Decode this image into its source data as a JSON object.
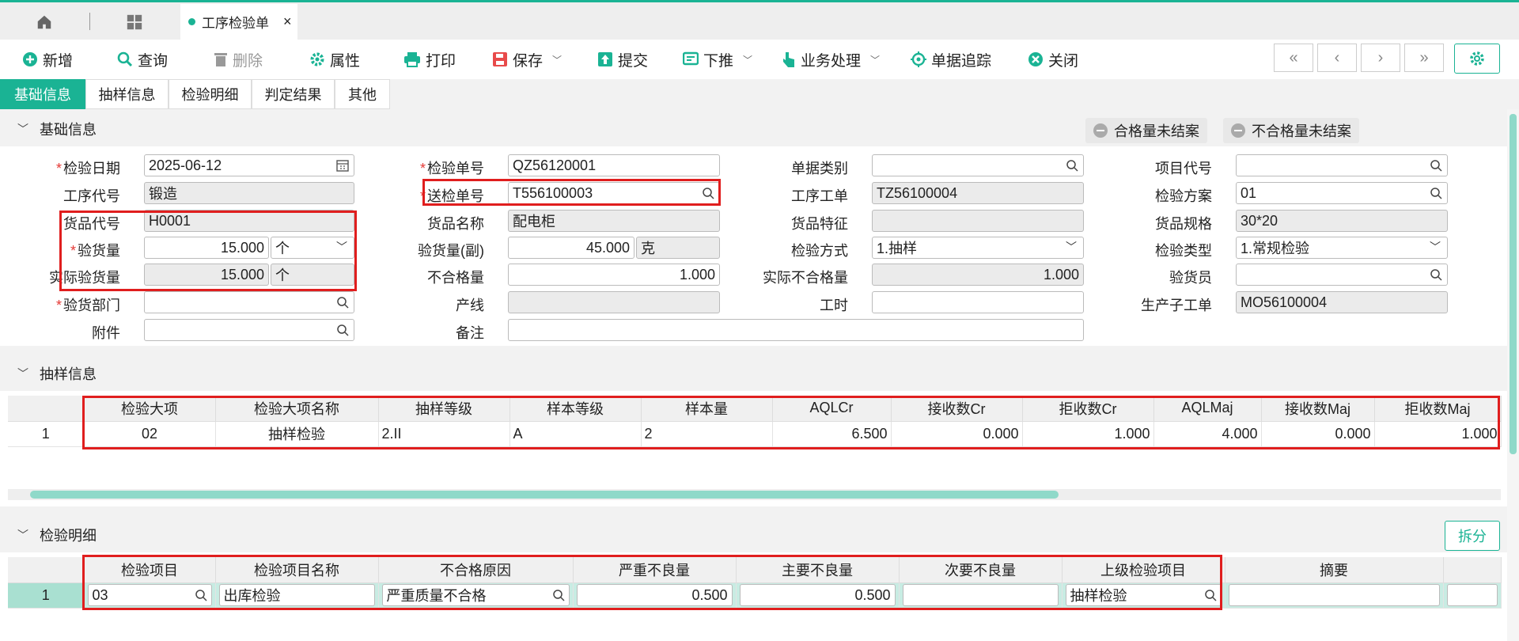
{
  "tabbar": {
    "doc_tab": "工序检验单",
    "close": "×"
  },
  "toolbar": {
    "new": "新增",
    "query": "查询",
    "delete": "删除",
    "attr": "属性",
    "print": "打印",
    "save": "保存",
    "submit": "提交",
    "push": "下推",
    "business": "业务处理",
    "trace": "单据追踪",
    "close": "关闭",
    "nav": [
      "«",
      "‹",
      "›",
      "»"
    ]
  },
  "subtabs": [
    "基础信息",
    "抽样信息",
    "检验明细",
    "判定结果",
    "其他"
  ],
  "basic": {
    "title": "基础信息",
    "pill_ok": "合格量未结案",
    "pill_ng": "不合格量未结案",
    "labels": {
      "check_date": "检验日期",
      "process_code": "工序代号",
      "goods_code": "货品代号",
      "check_qty": "验货量",
      "actual_qty": "实际验货量",
      "dept": "验货部门",
      "attach": "附件",
      "check_no": "检验单号",
      "send_no": "送检单号",
      "goods_name": "货品名称",
      "qty_sub": "验货量(副)",
      "ng_qty": "不合格量",
      "line": "产线",
      "remark": "备注",
      "doc_type": "单据类别",
      "process_order": "工序工单",
      "goods_feature": "货品特征",
      "check_method": "检验方式",
      "actual_ng": "实际不合格量",
      "work_hours": "工时",
      "project_code": "项目代号",
      "check_plan": "检验方案",
      "goods_spec": "货品规格",
      "check_type": "检验类型",
      "inspector": "验货员",
      "prod_order": "生产子工单"
    },
    "values": {
      "check_date": "2025-06-12",
      "process_code": "锻造",
      "goods_code": "H0001",
      "check_qty": "15.000",
      "check_unit": "个",
      "actual_qty": "15.000",
      "actual_unit": "个",
      "dept": "",
      "attach": "",
      "check_no": "QZ56120001",
      "send_no": "T556100003",
      "goods_name": "配电柜",
      "qty_sub": "45.000",
      "sub_unit": "克",
      "ng_qty": "1.000",
      "line": "",
      "remark": "",
      "doc_type": "",
      "process_order": "TZ56100004",
      "goods_feature": "",
      "check_method": "1.抽样",
      "actual_ng": "1.000",
      "work_hours": "",
      "project_code": "",
      "check_plan": "01",
      "goods_spec": "30*20",
      "check_type": "1.常规检验",
      "inspector": "",
      "prod_order": "MO56100004"
    }
  },
  "sampling": {
    "title": "抽样信息",
    "columns": [
      "检验大项",
      "检验大项名称",
      "抽样等级",
      "样本等级",
      "样本量",
      "AQLCr",
      "接收数Cr",
      "拒收数Cr",
      "AQLMaj",
      "接收数Maj",
      "拒收数Maj"
    ],
    "rows": [
      {
        "no": "1",
        "cells": [
          "02",
          "抽样检验",
          "2.II",
          "A",
          "2",
          "6.500",
          "0.000",
          "1.000",
          "4.000",
          "0.000",
          "1.000"
        ]
      }
    ]
  },
  "detail": {
    "title": "检验明细",
    "split": "拆分",
    "columns": [
      "检验项目",
      "检验项目名称",
      "不合格原因",
      "严重不良量",
      "主要不良量",
      "次要不良量",
      "上级检验项目",
      "摘要"
    ],
    "rows": [
      {
        "no": "1",
        "cells": [
          "03",
          "出库检验",
          "严重质量不合格",
          "0.500",
          "0.500",
          "",
          "抽样检验",
          ""
        ]
      }
    ]
  },
  "colors": {
    "accent": "#1ab394",
    "highlight": "#e01e1e",
    "required": "#e53935"
  }
}
